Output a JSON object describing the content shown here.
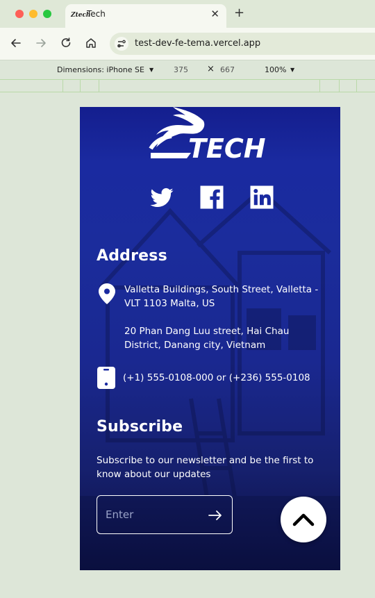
{
  "browser": {
    "tab_title": "Tech",
    "tab_favicon": "Ztech",
    "url": "test-dev-fe-tema.vercel.app"
  },
  "devtools": {
    "device_label": "Dimensions: iPhone SE",
    "width": "375",
    "times": "×",
    "height": "667",
    "zoom": "100%"
  },
  "footer": {
    "logo_text": "TECH",
    "socials": [
      "twitter-icon",
      "facebook-icon",
      "linkedin-icon"
    ],
    "address_heading": "Address",
    "address_1": "Valletta Buildings, South Street, Valletta - VLT 1103 Malta, US",
    "address_2": "20 Phan Dang Luu street, Hai Chau District, Danang city, Vietnam",
    "phones": "(+1) 555-0108-000 or (+236) 555-0108",
    "subscribe_heading": "Subscribe",
    "subscribe_desc": "Subscribe to our newsletter and be the first to know about our updates",
    "email_placeholder": "Enter"
  },
  "colors": {
    "footer_bg": "#1a2aa0",
    "text": "#ffffff"
  }
}
